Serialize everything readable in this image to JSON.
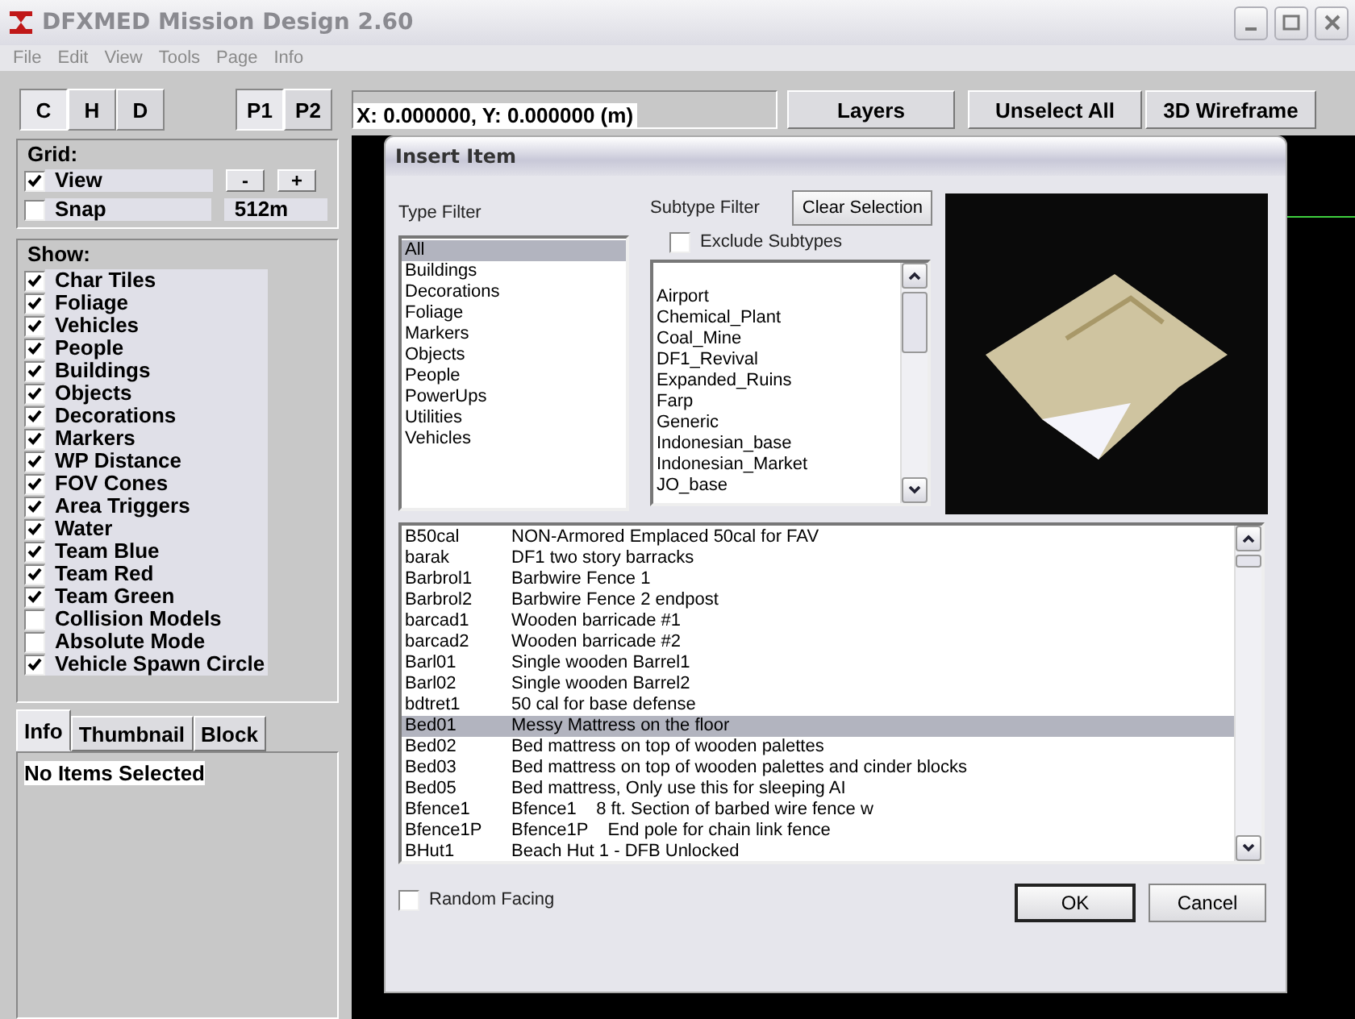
{
  "window": {
    "title": "DFXMED Mission Design 2.60"
  },
  "menu": [
    "File",
    "Edit",
    "View",
    "Tools",
    "Page",
    "Info"
  ],
  "mode_buttons": [
    {
      "label": "C",
      "selected": true
    },
    {
      "label": "H",
      "selected": false
    },
    {
      "label": "D",
      "selected": false
    }
  ],
  "page_buttons": [
    {
      "label": "P1",
      "selected": true
    },
    {
      "label": "P2",
      "selected": false
    }
  ],
  "coordinates": "X: 0.000000, Y: 0.000000 (m)",
  "toolbar_buttons": [
    "Layers",
    "Unselect All",
    "3D Wireframe"
  ],
  "grid": {
    "title": "Grid:",
    "options": [
      {
        "label": "View",
        "checked": true
      },
      {
        "label": "Snap",
        "checked": false
      }
    ],
    "zoom_buttons": [
      "-",
      "+"
    ],
    "size": "512m"
  },
  "show": {
    "title": "Show:",
    "options": [
      {
        "label": "Char Tiles",
        "checked": true
      },
      {
        "label": "Foliage",
        "checked": true
      },
      {
        "label": "Vehicles",
        "checked": true
      },
      {
        "label": "People",
        "checked": true
      },
      {
        "label": "Buildings",
        "checked": true
      },
      {
        "label": "Objects",
        "checked": true
      },
      {
        "label": "Decorations",
        "checked": true
      },
      {
        "label": "Markers",
        "checked": true
      },
      {
        "label": "WP Distance",
        "checked": true
      },
      {
        "label": "FOV Cones",
        "checked": true
      },
      {
        "label": "Area Triggers",
        "checked": true
      },
      {
        "label": "Water",
        "checked": true
      },
      {
        "label": "Team Blue",
        "checked": true
      },
      {
        "label": "Team Red",
        "checked": true
      },
      {
        "label": "Team Green",
        "checked": true
      },
      {
        "label": "Collision Models",
        "checked": false
      },
      {
        "label": "Absolute Mode",
        "checked": false
      },
      {
        "label": "Vehicle Spawn Circle",
        "checked": true
      }
    ]
  },
  "info_tabs": [
    {
      "label": "Info",
      "selected": true
    },
    {
      "label": "Thumbnail",
      "selected": false
    },
    {
      "label": "Block",
      "selected": false
    }
  ],
  "info_text": "No Items Selected",
  "dialog": {
    "title": "Insert Item",
    "type_filter": {
      "label": "Type Filter",
      "items": [
        {
          "label": "All",
          "selected": true
        },
        {
          "label": "Buildings",
          "selected": false
        },
        {
          "label": "Decorations",
          "selected": false
        },
        {
          "label": "Foliage",
          "selected": false
        },
        {
          "label": "Markers",
          "selected": false
        },
        {
          "label": "Objects",
          "selected": false
        },
        {
          "label": "People",
          "selected": false
        },
        {
          "label": "PowerUps",
          "selected": false
        },
        {
          "label": "Utilities",
          "selected": false
        },
        {
          "label": "Vehicles",
          "selected": false
        }
      ]
    },
    "subtype_filter": {
      "label": "Subtype Filter",
      "clear_button": "Clear Selection",
      "exclude": {
        "label": "Exclude Subtypes",
        "checked": false
      },
      "items": [
        "Airport",
        "Chemical_Plant",
        "Coal_Mine",
        "DF1_Revival",
        "Expanded_Ruins",
        "Farp",
        "Generic",
        "Indonesian_base",
        "Indonesian_Market",
        "JO_base"
      ]
    },
    "items": [
      {
        "code": "B50cal",
        "description": "NON-Armored Emplaced 50cal for FAV",
        "selected": false
      },
      {
        "code": "barak",
        "description": "DF1 two story barracks",
        "selected": false
      },
      {
        "code": "Barbrol1",
        "description": "Barbwire Fence 1",
        "selected": false
      },
      {
        "code": "Barbrol2",
        "description": "Barbwire Fence 2 endpost",
        "selected": false
      },
      {
        "code": "barcad1",
        "description": "Wooden barricade #1",
        "selected": false
      },
      {
        "code": "barcad2",
        "description": "Wooden barricade #2",
        "selected": false
      },
      {
        "code": "Barl01",
        "description": "Single wooden Barrel1",
        "selected": false
      },
      {
        "code": "Barl02",
        "description": "Single wooden Barrel2",
        "selected": false
      },
      {
        "code": "bdtret1",
        "description": "50 cal for base defense",
        "selected": false
      },
      {
        "code": "Bed01",
        "description": "Messy Mattress on the floor",
        "selected": true
      },
      {
        "code": "Bed02",
        "description": "Bed mattress on top of wooden palettes",
        "selected": false
      },
      {
        "code": "Bed03",
        "description": "Bed mattress on top of wooden palettes and cinder blocks",
        "selected": false
      },
      {
        "code": "Bed05",
        "description": "Bed mattress, Only use this for sleeping AI",
        "selected": false
      },
      {
        "code": "Bfence1",
        "description": "Bfence1    8 ft. Section of barbed wire fence w",
        "selected": false
      },
      {
        "code": "Bfence1P",
        "description": "Bfence1P    End pole for chain link fence",
        "selected": false
      },
      {
        "code": "BHut1",
        "description": "Beach Hut 1 - DFB Unlocked",
        "selected": false
      }
    ],
    "random_facing": {
      "label": "Random Facing",
      "checked": false
    },
    "buttons": [
      "OK",
      "Cancel"
    ]
  }
}
